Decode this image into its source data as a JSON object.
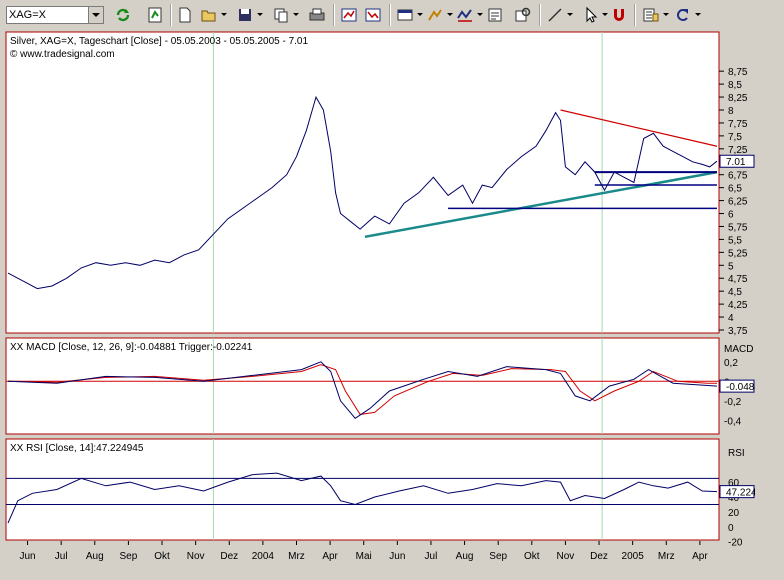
{
  "toolbar": {
    "symbol_value": "XAG=X",
    "icons": [
      "refresh-icon",
      "chart-update-icon",
      "new-document-icon",
      "open-folder-icon",
      "save-icon",
      "copy-icon",
      "print-icon",
      "chart-window-icon",
      "chart-compare-icon",
      "chart-style-icon",
      "drawing-tools-icon",
      "indicator-icon",
      "properties-icon",
      "line-tool-icon",
      "pointer-icon",
      "magnet-icon",
      "settings-list-icon",
      "undo-icon"
    ]
  },
  "colors": {
    "price_line": "#000066",
    "macd_line": "#000066",
    "trigger_line": "#d00000",
    "resistance_line": "#d00000",
    "support_line": "#1a8a8a",
    "horizontal_line": "#000080",
    "grid": "#a8d8a8",
    "panel_bg": "#ffffff",
    "panel_border": "#b00000"
  },
  "chart_data": [
    {
      "type": "line",
      "title": "Silver, XAG=X, Tageschart [Close] - 05.05.2003 - 05.05.2005 - 7.01",
      "subtitle": "© www.tradesignal.com",
      "ylim": [
        3.75,
        8.85
      ],
      "y_ticks": [
        "8,75",
        "8,5",
        "8,25",
        "8",
        "7,75",
        "7,5",
        "7,25",
        "7",
        "6,75",
        "6,5",
        "6,25",
        "6",
        "5,75",
        "5,5",
        "5,25",
        "5",
        "4,75",
        "4,5",
        "4,25",
        "4",
        "3,75"
      ],
      "last_value_label": "7.01",
      "x_months": [
        "Jun",
        "Jul",
        "Aug",
        "Sep",
        "Okt",
        "Nov",
        "Dez",
        "2004",
        "Mrz",
        "Apr",
        "Mai",
        "Jun",
        "Jul",
        "Aug",
        "Sep",
        "Okt",
        "Nov",
        "Dez",
        "2005",
        "Mrz",
        "Apr"
      ],
      "series": [
        {
          "points": [
            [
              0,
              4.85
            ],
            [
              6,
              4.7
            ],
            [
              12,
              4.55
            ],
            [
              18,
              4.6
            ],
            [
              24,
              4.75
            ],
            [
              30,
              4.95
            ],
            [
              36,
              5.05
            ],
            [
              42,
              5.0
            ],
            [
              48,
              5.05
            ],
            [
              54,
              5.0
            ],
            [
              60,
              5.1
            ],
            [
              66,
              5.05
            ],
            [
              72,
              5.2
            ],
            [
              78,
              5.3
            ],
            [
              84,
              5.6
            ],
            [
              90,
              5.9
            ],
            [
              96,
              6.1
            ],
            [
              102,
              6.3
            ],
            [
              108,
              6.5
            ],
            [
              114,
              6.75
            ],
            [
              118,
              7.1
            ],
            [
              122,
              7.6
            ],
            [
              126,
              8.25
            ],
            [
              129,
              8.0
            ],
            [
              132,
              7.2
            ],
            [
              134,
              6.4
            ],
            [
              136,
              6.0
            ],
            [
              140,
              5.85
            ],
            [
              144,
              5.7
            ],
            [
              150,
              5.95
            ],
            [
              156,
              5.8
            ],
            [
              162,
              6.2
            ],
            [
              168,
              6.4
            ],
            [
              174,
              6.7
            ],
            [
              180,
              6.35
            ],
            [
              186,
              6.55
            ],
            [
              190,
              6.2
            ],
            [
              194,
              6.55
            ],
            [
              198,
              6.5
            ],
            [
              204,
              6.85
            ],
            [
              210,
              7.1
            ],
            [
              216,
              7.3
            ],
            [
              220,
              7.6
            ],
            [
              224,
              7.95
            ],
            [
              226,
              7.8
            ],
            [
              228,
              6.9
            ],
            [
              232,
              6.75
            ],
            [
              236,
              7.0
            ],
            [
              240,
              6.8
            ],
            [
              244,
              6.45
            ],
            [
              248,
              6.8
            ],
            [
              252,
              6.7
            ],
            [
              256,
              6.6
            ],
            [
              260,
              7.45
            ],
            [
              264,
              7.55
            ],
            [
              268,
              7.3
            ],
            [
              272,
              7.2
            ],
            [
              276,
              7.1
            ],
            [
              280,
              7.0
            ],
            [
              284,
              6.95
            ],
            [
              287,
              6.9
            ],
            [
              290,
              7.01
            ]
          ]
        }
      ],
      "trendlines": [
        {
          "name": "support",
          "from": [
            146,
            5.55
          ],
          "to": [
            290,
            6.8
          ]
        },
        {
          "name": "resistance",
          "from": [
            226,
            8.0
          ],
          "to": [
            290,
            7.3
          ]
        },
        {
          "name": "horizontal-1",
          "from": [
            240,
            6.8
          ],
          "to": [
            290,
            6.8
          ]
        },
        {
          "name": "horizontal-2",
          "from": [
            240,
            6.55
          ],
          "to": [
            290,
            6.55
          ]
        },
        {
          "name": "horizontal-3",
          "from": [
            180,
            6.1
          ],
          "to": [
            290,
            6.1
          ]
        }
      ]
    },
    {
      "type": "line",
      "title": "XX MACD [Close, 12, 26, 9]:-0.04881 Trigger:-0.02241",
      "ylim": [
        -0.5,
        0.3
      ],
      "y_ticks": [
        "MACD",
        "0,2",
        "0",
        "-0,2",
        "-0,4"
      ],
      "last_value_label": "-0.0488",
      "series": [
        {
          "name": "MACD",
          "points": [
            [
              0,
              0
            ],
            [
              20,
              -0.02
            ],
            [
              40,
              0.05
            ],
            [
              60,
              0.04
            ],
            [
              80,
              0.0
            ],
            [
              100,
              0.06
            ],
            [
              120,
              0.12
            ],
            [
              128,
              0.2
            ],
            [
              132,
              0.1
            ],
            [
              136,
              -0.2
            ],
            [
              142,
              -0.38
            ],
            [
              148,
              -0.28
            ],
            [
              156,
              -0.1
            ],
            [
              170,
              0.02
            ],
            [
              180,
              0.1
            ],
            [
              192,
              0.05
            ],
            [
              204,
              0.15
            ],
            [
              220,
              0.12
            ],
            [
              226,
              0.08
            ],
            [
              232,
              -0.15
            ],
            [
              238,
              -0.2
            ],
            [
              246,
              -0.05
            ],
            [
              256,
              0.02
            ],
            [
              262,
              0.12
            ],
            [
              272,
              -0.02
            ],
            [
              284,
              -0.04
            ],
            [
              290,
              -0.05
            ]
          ]
        },
        {
          "name": "Trigger",
          "points": [
            [
              0,
              0
            ],
            [
              20,
              -0.01
            ],
            [
              40,
              0.04
            ],
            [
              60,
              0.05
            ],
            [
              80,
              0.01
            ],
            [
              100,
              0.05
            ],
            [
              120,
              0.1
            ],
            [
              128,
              0.17
            ],
            [
              134,
              0.12
            ],
            [
              138,
              -0.1
            ],
            [
              144,
              -0.34
            ],
            [
              150,
              -0.32
            ],
            [
              158,
              -0.15
            ],
            [
              172,
              0.0
            ],
            [
              182,
              0.08
            ],
            [
              194,
              0.06
            ],
            [
              206,
              0.13
            ],
            [
              222,
              0.12
            ],
            [
              228,
              0.1
            ],
            [
              234,
              -0.1
            ],
            [
              240,
              -0.2
            ],
            [
              248,
              -0.1
            ],
            [
              258,
              0.0
            ],
            [
              264,
              0.1
            ],
            [
              274,
              0.0
            ],
            [
              286,
              -0.02
            ],
            [
              290,
              -0.02
            ]
          ]
        }
      ]
    },
    {
      "type": "line",
      "title": "XX RSI [Close, 14]:47.224945",
      "ylim": [
        -15,
        95
      ],
      "y_ticks": [
        "RSI",
        "60",
        "40",
        "20",
        "0",
        "-20"
      ],
      "last_value_label": "47.2249",
      "series": [
        {
          "name": "RSI",
          "points": [
            [
              0,
              5
            ],
            [
              4,
              35
            ],
            [
              10,
              45
            ],
            [
              20,
              50
            ],
            [
              30,
              65
            ],
            [
              40,
              55
            ],
            [
              50,
              60
            ],
            [
              60,
              50
            ],
            [
              70,
              55
            ],
            [
              80,
              48
            ],
            [
              90,
              60
            ],
            [
              100,
              70
            ],
            [
              110,
              72
            ],
            [
              120,
              62
            ],
            [
              128,
              68
            ],
            [
              132,
              55
            ],
            [
              136,
              35
            ],
            [
              142,
              30
            ],
            [
              150,
              40
            ],
            [
              160,
              48
            ],
            [
              170,
              55
            ],
            [
              180,
              45
            ],
            [
              190,
              50
            ],
            [
              200,
              58
            ],
            [
              210,
              55
            ],
            [
              220,
              62
            ],
            [
              226,
              60
            ],
            [
              230,
              35
            ],
            [
              236,
              42
            ],
            [
              244,
              38
            ],
            [
              252,
              50
            ],
            [
              258,
              60
            ],
            [
              264,
              55
            ],
            [
              270,
              52
            ],
            [
              278,
              60
            ],
            [
              284,
              48
            ],
            [
              290,
              47.2
            ]
          ]
        }
      ],
      "hlines": [
        65,
        30
      ]
    }
  ]
}
